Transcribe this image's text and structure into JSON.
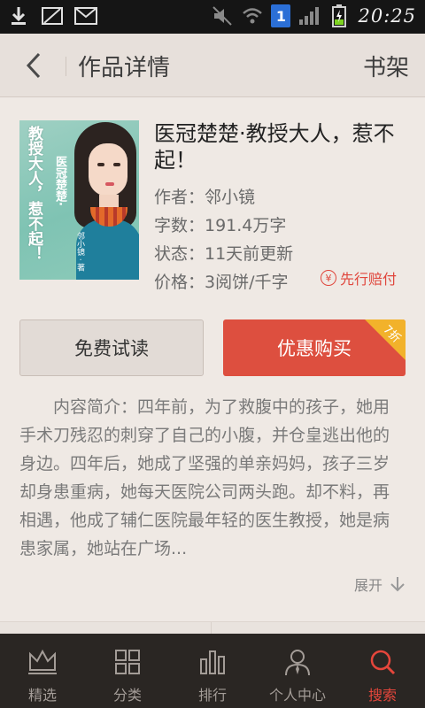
{
  "status_bar": {
    "time": "20:25",
    "badge": "1"
  },
  "nav": {
    "title": "作品详情",
    "right_label": "书架"
  },
  "book": {
    "cover_text": "教授大人，惹不起！",
    "cover_side_title": "医冠楚楚·",
    "cover_author": "邻小镜 · 著",
    "title": "医冠楚楚·教授大人，惹不起！",
    "author": "作者：邻小镜",
    "words": "字数：191.4万字",
    "status": "状态：11天前更新",
    "price": "价格：3阅饼/千字",
    "pay_badge": "先行赔付",
    "pay_badge_icon": "¥"
  },
  "actions": {
    "free_read": "免费试读",
    "buy": "优惠购买",
    "discount": "7折"
  },
  "intro": {
    "text": "内容简介：四年前，为了救腹中的孩子，她用手术刀残忍的刺穿了自己的小腹，并仓皇逃出他的身边。四年后，她成了坚强的单亲妈妈，孩子三岁却身患重病，她每天医院公司两头跑。却不料，再相遇，他成了辅仁医院最年轻的医生教授，她是病患家属，她站在广场...",
    "expand": "展开"
  },
  "tabs": [
    {
      "label": "精选",
      "icon": "crown-icon"
    },
    {
      "label": "分类",
      "icon": "grid-icon"
    },
    {
      "label": "排行",
      "icon": "bar-chart-icon"
    },
    {
      "label": "个人中心",
      "icon": "user-icon"
    },
    {
      "label": "搜索",
      "icon": "search-icon",
      "active": true
    }
  ],
  "colors": {
    "accent": "#e5463b",
    "buy_button": "#dd4f3f",
    "discount_corner": "#f2b22b",
    "status_bar": "#151515",
    "tab_bar": "#2a2623"
  }
}
